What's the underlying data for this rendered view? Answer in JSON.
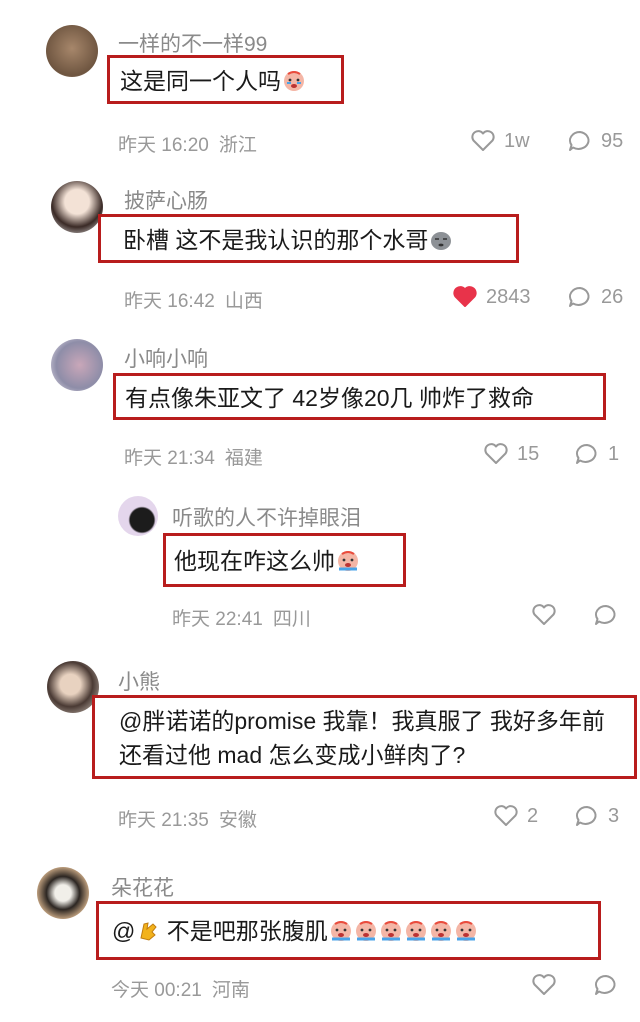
{
  "comments": [
    {
      "username": "一样的不一样99",
      "text": "这是同一个人吗",
      "time": "昨天 16:20",
      "location": "浙江",
      "likes": "1w",
      "replies": "95",
      "liked": false,
      "emoji": "crying-face-emoji"
    },
    {
      "username": "披萨心肠",
      "text": "卧槽 这不是我认识的那个水哥",
      "time": "昨天 16:42",
      "location": "山西",
      "likes": "2843",
      "replies": "26",
      "liked": true,
      "emoji": "rock-face-emoji"
    },
    {
      "username": "小响小响",
      "text": "有点像朱亚文了 42岁像20几 帅炸了救命",
      "time": "昨天 21:34",
      "location": "福建",
      "likes": "15",
      "replies": "1",
      "liked": false
    },
    {
      "username": "听歌的人不许掉眼泪",
      "text": "他现在咋这么帅",
      "time": "昨天 22:41",
      "location": "四川",
      "is_reply": true,
      "emoji": "crying-face-emoji"
    },
    {
      "username": "小熊",
      "text": "@胖诺诺的promise 我靠！我真服了 我好多年前还看过他 mad 怎么变成小鲜肉了?",
      "time": "昨天 21:35",
      "location": "安徽",
      "likes": "2",
      "replies": "3",
      "liked": false
    },
    {
      "username": "朵花花",
      "text_prefix": "@",
      "text": " 不是吧那张腹肌",
      "time": "今天 00:21",
      "location": "河南",
      "emoji": "clap-hands-emoji",
      "trailing_emoji_count": 6
    }
  ],
  "colors": {
    "highlight_border": "#b81d1d",
    "like_active": "#e8334a",
    "meta_gray": "#999999"
  }
}
